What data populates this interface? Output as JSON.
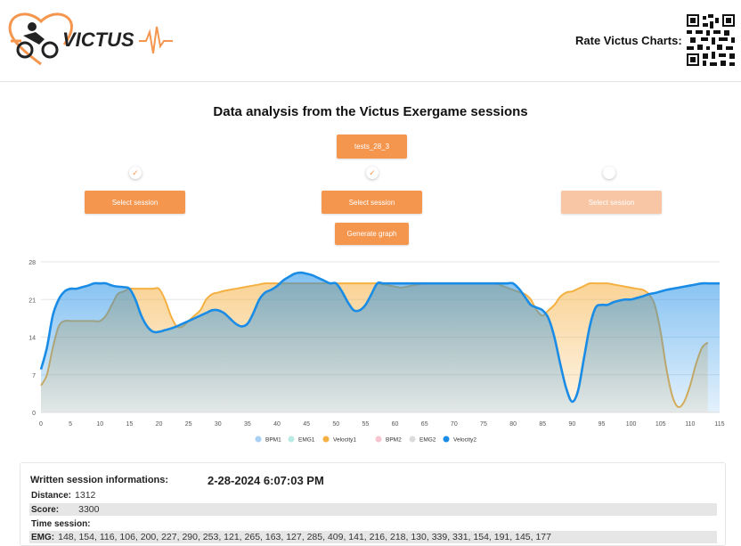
{
  "header": {
    "logo_text": "VICTUS",
    "rate_label": "Rate Victus Charts:"
  },
  "page_title": "Data analysis from the Victus Exergame sessions",
  "session_file_button": "tests_28_3",
  "session_pickers": [
    {
      "checked": true,
      "label": "Select session",
      "enabled": true
    },
    {
      "checked": true,
      "label": "Select session",
      "enabled": true
    },
    {
      "checked": false,
      "label": "Select session",
      "enabled": false
    }
  ],
  "generate_button": "Generate graph",
  "chart_data": {
    "type": "area",
    "x": [
      0,
      1,
      2,
      3,
      4,
      5,
      6,
      7,
      8,
      9,
      10,
      11,
      12,
      13,
      14,
      15,
      16,
      17,
      18,
      19,
      20,
      21,
      22,
      23,
      24,
      25,
      26,
      27,
      28,
      29,
      30,
      31,
      32,
      33,
      34,
      35,
      36,
      37,
      38,
      39,
      40,
      41,
      42,
      43,
      44,
      45,
      46,
      47,
      48,
      49,
      50,
      51,
      52,
      53,
      54,
      55,
      56,
      57,
      58,
      59,
      60,
      61,
      62,
      63,
      64,
      65,
      66,
      67,
      68,
      69,
      70,
      71,
      72,
      73,
      74,
      75,
      76,
      77,
      78,
      79,
      80,
      81,
      82,
      83,
      84,
      85,
      86,
      87,
      88,
      89,
      90,
      91,
      92,
      93,
      94,
      95,
      96,
      97,
      98,
      99,
      100,
      101,
      102,
      103,
      104,
      105,
      106,
      107,
      108,
      109,
      110,
      111,
      112,
      113,
      114,
      115
    ],
    "xticks": [
      0,
      5,
      10,
      15,
      20,
      25,
      30,
      35,
      40,
      45,
      50,
      55,
      60,
      65,
      70,
      75,
      80,
      85,
      90,
      95,
      100,
      105,
      110,
      115
    ],
    "yticks": [
      0,
      7,
      14,
      21,
      28
    ],
    "ylim": [
      0,
      28
    ],
    "series": [
      {
        "name": "BPM1",
        "color": "#a9d0f5",
        "values": []
      },
      {
        "name": "EMG1",
        "color": "#b9ebe4",
        "values": []
      },
      {
        "name": "Velocity1",
        "color": "#f5b042",
        "values": [
          5,
          7,
          12,
          16,
          17,
          17,
          17,
          17,
          17,
          17,
          17,
          18,
          20,
          22,
          22.5,
          23,
          23,
          23,
          23,
          23,
          23,
          21,
          18,
          16,
          16,
          17,
          18,
          19,
          21,
          22,
          22.3,
          22.6,
          22.8,
          23,
          23.2,
          23.4,
          23.6,
          23.8,
          24,
          24,
          24,
          24,
          24,
          24,
          24,
          24,
          24,
          24,
          24,
          24,
          24,
          24,
          24,
          24,
          24,
          24,
          24,
          24,
          23.8,
          23.6,
          23.4,
          23.2,
          23.4,
          23.6,
          23.8,
          24,
          24,
          24,
          24,
          24,
          24,
          24,
          24,
          24,
          24,
          24,
          24,
          24,
          23.6,
          23.2,
          22.8,
          22.4,
          22,
          21,
          19,
          18,
          19,
          20,
          21.5,
          22.3,
          22.5,
          23,
          23.5,
          24,
          24,
          24,
          24,
          23.8,
          23.6,
          23.4,
          23.2,
          23,
          22.8,
          22,
          20,
          15,
          8,
          3,
          1,
          2,
          5,
          9,
          12,
          13
        ]
      },
      {
        "name": "BPM2",
        "color": "#f6c5cf",
        "values": []
      },
      {
        "name": "EMG2",
        "color": "#dcdcdc",
        "values": []
      },
      {
        "name": "Velocity2",
        "color": "#1a8ce6",
        "values": [
          8,
          12,
          18,
          21,
          22.5,
          23,
          23,
          23.3,
          23.6,
          24,
          24,
          24,
          23.6,
          23.4,
          23.3,
          23,
          21,
          18,
          16,
          15,
          15,
          15.3,
          15.6,
          16,
          16.5,
          17,
          17.5,
          18,
          18.5,
          19,
          19,
          18.5,
          17.5,
          16.5,
          16,
          16.5,
          18.5,
          21,
          22.3,
          22.8,
          23.5,
          24.5,
          25.2,
          25.8,
          26,
          25.8,
          25.5,
          25,
          24.5,
          24,
          24,
          22.5,
          20.5,
          19,
          19,
          20,
          22,
          24,
          24,
          24,
          24,
          24,
          24,
          24,
          24,
          24,
          24,
          24,
          24,
          24,
          24,
          24,
          24,
          24,
          24,
          24,
          24,
          24,
          24,
          24,
          24,
          23,
          21.5,
          20,
          19.5,
          19,
          17.5,
          14,
          9,
          4.5,
          2,
          4,
          10,
          16,
          19.5,
          20,
          20,
          20.5,
          20.8,
          21,
          21,
          21.3,
          21.6,
          22,
          22.2,
          22.5,
          22.8,
          23,
          23.2,
          23.4,
          23.6,
          23.8,
          24,
          24,
          24,
          24
        ]
      }
    ]
  },
  "session_info": {
    "title": "Written session informations:",
    "date": "2-28-2024 6:07:03 PM",
    "distance_label": "Distance:",
    "distance_value": "1312",
    "score_label": "Score:",
    "score_value": "3300",
    "time_label": "Time session:",
    "time_value": "",
    "emg_label": "EMG:",
    "emg_value": "148, 154, 116, 106, 200, 227, 290, 253, 121, 265, 163, 127, 285, 409, 141, 216, 218, 130, 339, 331, 154, 191, 145, 177"
  }
}
